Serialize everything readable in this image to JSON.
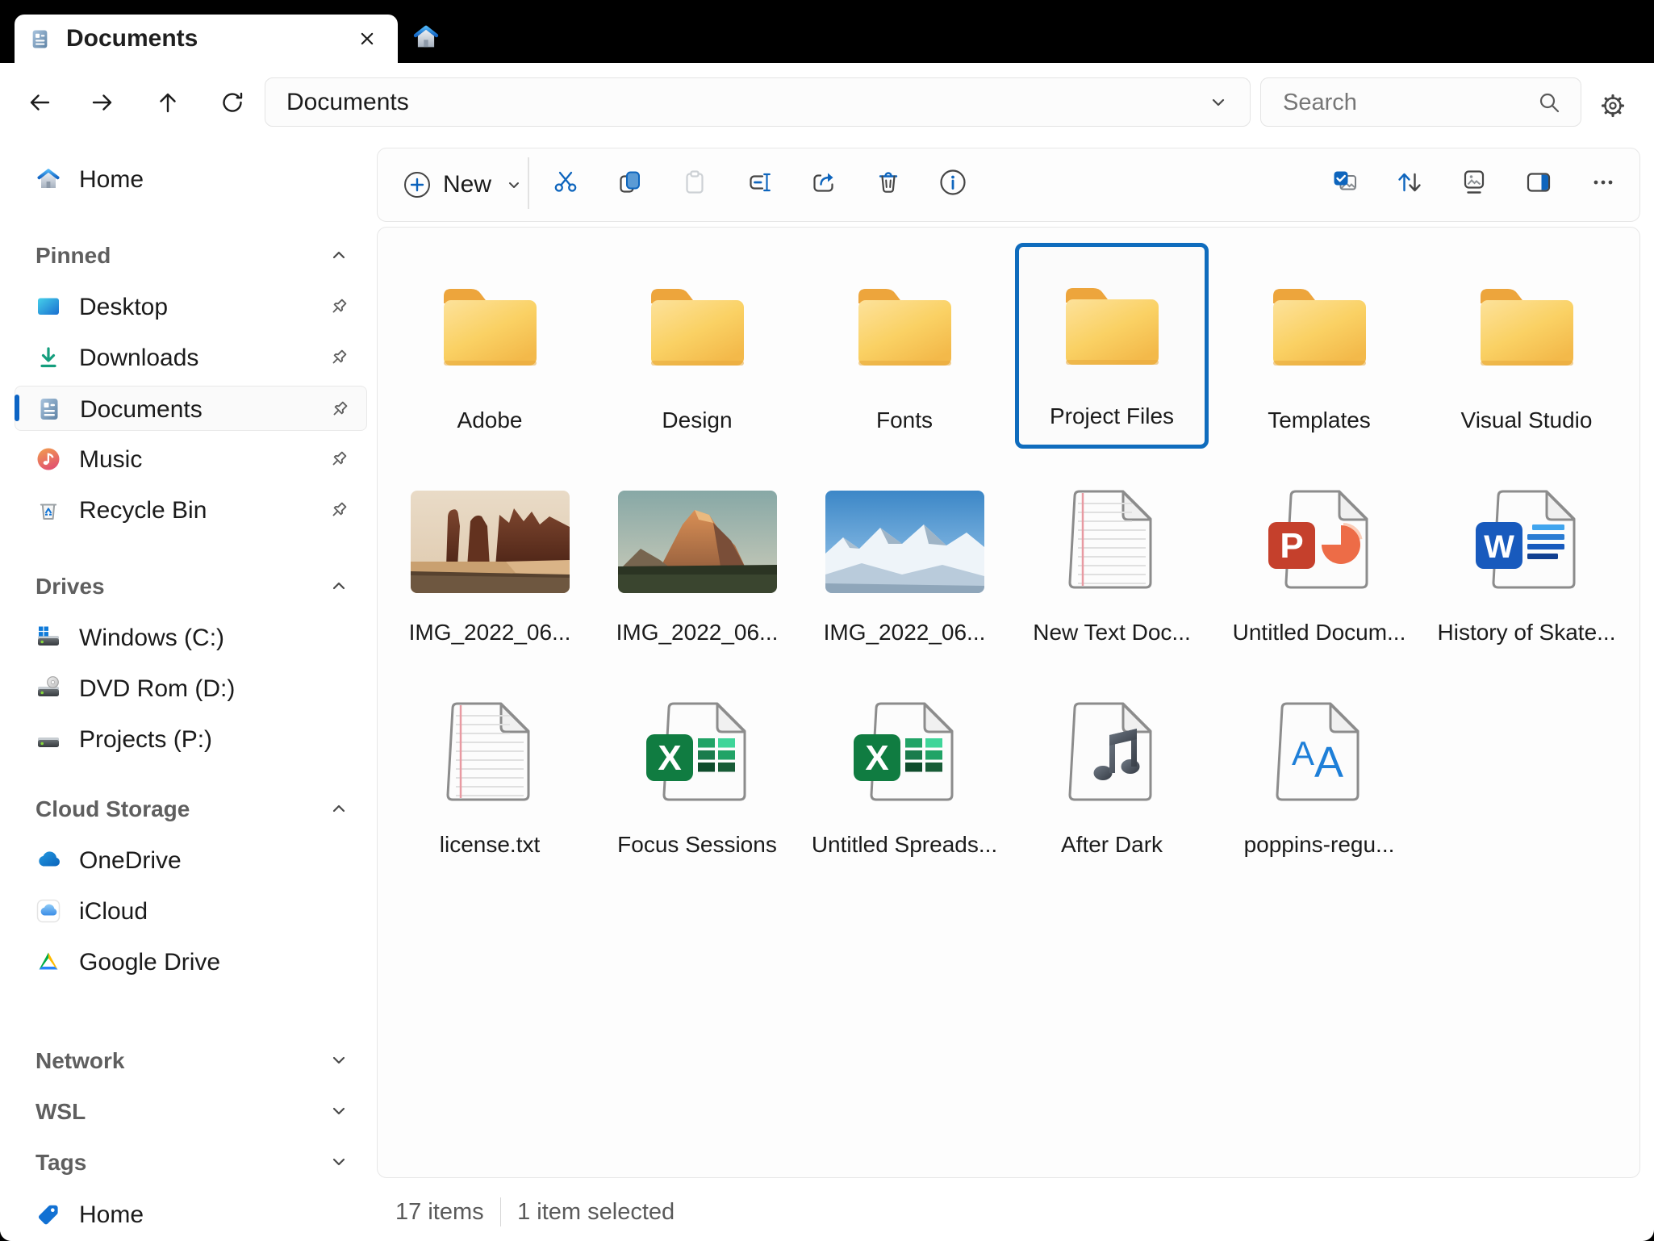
{
  "window": {
    "tab_title": "Documents"
  },
  "toolbar": {
    "address": "Documents",
    "search_placeholder": "Search"
  },
  "command_bar": {
    "new_label": "New",
    "left_icons": [
      {
        "name": "cut",
        "enabled": true
      },
      {
        "name": "copy",
        "enabled": true
      },
      {
        "name": "paste",
        "enabled": false
      },
      {
        "name": "rename",
        "enabled": true
      },
      {
        "name": "share",
        "enabled": true
      },
      {
        "name": "delete",
        "enabled": true
      },
      {
        "name": "info",
        "enabled": true
      }
    ],
    "right_icons": [
      {
        "name": "select-multiple"
      },
      {
        "name": "sort"
      },
      {
        "name": "view"
      },
      {
        "name": "details-pane"
      },
      {
        "name": "more"
      }
    ]
  },
  "sidebar": {
    "home": {
      "label": "Home",
      "icon": "home"
    },
    "sections": [
      {
        "label": "Pinned",
        "chevron": "up",
        "items": [
          {
            "label": "Desktop",
            "icon": "desktop",
            "pinned": true
          },
          {
            "label": "Downloads",
            "icon": "downloads",
            "pinned": true
          },
          {
            "label": "Documents",
            "icon": "document",
            "pinned": true,
            "selected": true
          },
          {
            "label": "Music",
            "icon": "music",
            "pinned": true
          },
          {
            "label": "Recycle Bin",
            "icon": "recycle-bin",
            "pinned": true
          }
        ]
      },
      {
        "label": "Drives",
        "chevron": "up",
        "items": [
          {
            "label": "Windows (C:)",
            "icon": "drive-windows"
          },
          {
            "label": "DVD Rom (D:)",
            "icon": "drive-dvd"
          },
          {
            "label": "Projects (P:)",
            "icon": "drive"
          }
        ]
      },
      {
        "label": "Cloud Storage",
        "chevron": "up",
        "items": [
          {
            "label": "OneDrive",
            "icon": "onedrive"
          },
          {
            "label": "iCloud",
            "icon": "icloud"
          },
          {
            "label": "Google Drive",
            "icon": "google-drive"
          }
        ]
      },
      {
        "label": "Network",
        "chevron": "down",
        "items": []
      },
      {
        "label": "WSL",
        "chevron": "down",
        "items": []
      },
      {
        "label": "Tags",
        "chevron": "down",
        "items": []
      }
    ],
    "footer": {
      "label": "Home",
      "icon": "tag"
    }
  },
  "files": [
    {
      "name": "Adobe",
      "icon": "folder"
    },
    {
      "name": "Design",
      "icon": "folder"
    },
    {
      "name": "Fonts",
      "icon": "folder"
    },
    {
      "name": "Project Files",
      "icon": "folder",
      "selected": true
    },
    {
      "name": "Templates",
      "icon": "folder"
    },
    {
      "name": "Visual Studio",
      "icon": "folder"
    },
    {
      "name": "IMG_2022_06...",
      "icon": "photo-desert"
    },
    {
      "name": "IMG_2022_06...",
      "icon": "photo-sunset-peak"
    },
    {
      "name": "IMG_2022_06...",
      "icon": "photo-snow-mountains"
    },
    {
      "name": "New Text Doc...",
      "icon": "text-file"
    },
    {
      "name": "Untitled Docum...",
      "icon": "powerpoint-file"
    },
    {
      "name": "History of Skate...",
      "icon": "word-file"
    },
    {
      "name": "license.txt",
      "icon": "text-file"
    },
    {
      "name": "Focus Sessions",
      "icon": "excel-file"
    },
    {
      "name": "Untitled Spreads...",
      "icon": "excel-file"
    },
    {
      "name": "After Dark",
      "icon": "audio-file"
    },
    {
      "name": "poppins-regu...",
      "icon": "font-file"
    }
  ],
  "status_bar": {
    "items_count": "17 items",
    "selection": "1 item selected"
  },
  "colors": {
    "accent": "#0f6cbd",
    "folder": "#f6c14a",
    "titlebar": "#000000"
  }
}
